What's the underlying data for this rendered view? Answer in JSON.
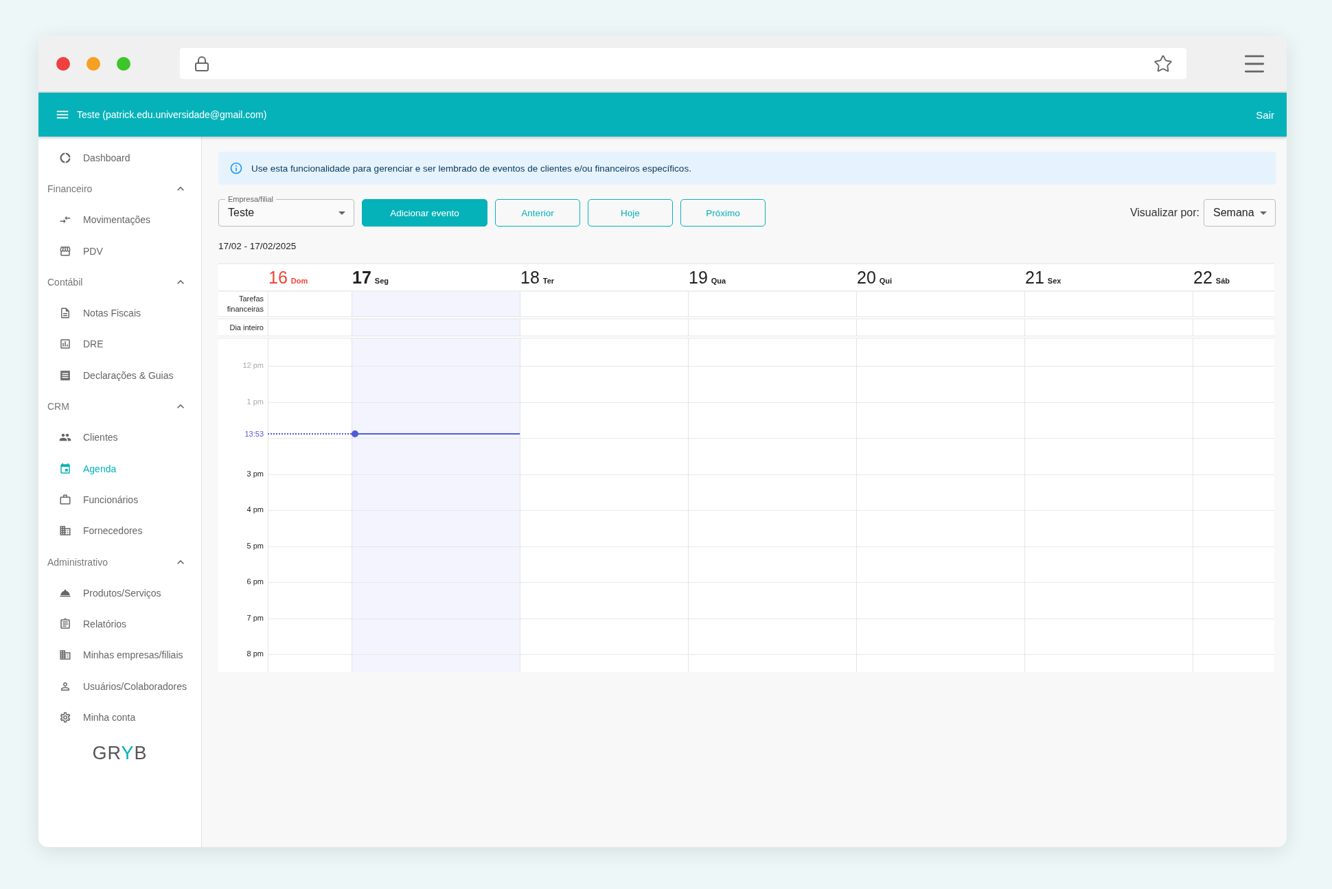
{
  "header": {
    "account": "Teste (patrick.edu.universidade@gmail.com)",
    "logout": "Sair"
  },
  "sidebar": {
    "items": [
      {
        "kind": "link",
        "label": "Dashboard",
        "selected": false
      },
      {
        "kind": "section",
        "label": "Financeiro",
        "expanded": true
      },
      {
        "kind": "link",
        "label": "Movimentações",
        "selected": false
      },
      {
        "kind": "link",
        "label": "PDV",
        "selected": false
      },
      {
        "kind": "section",
        "label": "Contábil",
        "expanded": true
      },
      {
        "kind": "link",
        "label": "Notas Fiscais",
        "selected": false
      },
      {
        "kind": "link",
        "label": "DRE",
        "selected": false
      },
      {
        "kind": "link",
        "label": "Declarações & Guias",
        "selected": false
      },
      {
        "kind": "section",
        "label": "CRM",
        "expanded": true
      },
      {
        "kind": "link",
        "label": "Clientes",
        "selected": false
      },
      {
        "kind": "link",
        "label": "Agenda",
        "selected": true
      },
      {
        "kind": "link",
        "label": "Funcionários",
        "selected": false
      },
      {
        "kind": "link",
        "label": "Fornecedores",
        "selected": false
      },
      {
        "kind": "section",
        "label": "Administrativo",
        "expanded": true
      },
      {
        "kind": "link",
        "label": "Produtos/Serviços",
        "selected": false
      },
      {
        "kind": "link",
        "label": "Relatórios",
        "selected": false
      },
      {
        "kind": "link",
        "label": "Minhas empresas/filiais",
        "selected": false
      },
      {
        "kind": "link",
        "label": "Usuários/Colaboradores",
        "selected": false
      },
      {
        "kind": "link",
        "label": "Minha conta",
        "selected": false
      }
    ],
    "logo": [
      {
        "text": "GR",
        "accent": false
      },
      {
        "text": "Y",
        "accent": true
      },
      {
        "text": "B",
        "accent": false
      }
    ]
  },
  "alert": {
    "text": "Use esta funcionalidade para gerenciar e ser lembrado de eventos de clientes e/ou financeiros específicos."
  },
  "toolbar": {
    "company_select": {
      "label": "Empresa/filial",
      "value": "Teste"
    },
    "buttons": [
      {
        "label": "Adicionar evento",
        "kind": "primary"
      },
      {
        "label": "Anterior",
        "kind": "outline"
      },
      {
        "label": "Hoje",
        "kind": "outline"
      },
      {
        "label": "Próximo",
        "kind": "outline"
      }
    ],
    "view_label": "Visualizar por:",
    "view_select": {
      "value": "Semana"
    }
  },
  "date_range": "17/02 - 17/02/2025",
  "calendar": {
    "days": [
      {
        "number": "16",
        "weekday": "Dom",
        "color": "#f44336",
        "selected": false
      },
      {
        "number": "17",
        "weekday": "Seg",
        "color": "#222222",
        "selected": true
      },
      {
        "number": "18",
        "weekday": "Ter",
        "color": "#222222",
        "selected": false
      },
      {
        "number": "19",
        "weekday": "Qua",
        "color": "#222222",
        "selected": false
      },
      {
        "number": "20",
        "weekday": "Qui",
        "color": "#222222",
        "selected": false
      },
      {
        "number": "21",
        "weekday": "Sex",
        "color": "#222222",
        "selected": false
      },
      {
        "number": "22",
        "weekday": "Sáb",
        "color": "#222222",
        "selected": false
      }
    ],
    "rows": [
      "Tarefas financeiras",
      "Dia inteiro"
    ],
    "slots": [
      {
        "kind": "labeled",
        "label": "12 pm",
        "past": true
      },
      {
        "kind": "labeled",
        "label": "1 pm",
        "past": true,
        "now": {
          "label": "13:53"
        }
      },
      {
        "kind": "unlabeled"
      },
      {
        "kind": "labeled",
        "label": "3 pm",
        "past": false
      },
      {
        "kind": "labeled",
        "label": "4 pm",
        "past": false
      },
      {
        "kind": "labeled",
        "label": "5 pm",
        "past": false
      },
      {
        "kind": "labeled",
        "label": "6 pm",
        "past": false
      },
      {
        "kind": "labeled",
        "label": "7 pm",
        "past": false
      },
      {
        "kind": "labeled",
        "label": "8 pm",
        "past": false
      }
    ]
  }
}
